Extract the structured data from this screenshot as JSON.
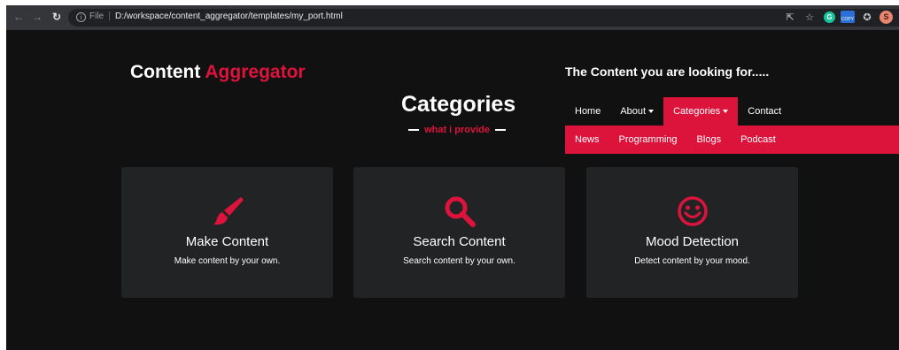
{
  "browser": {
    "back_icon": "arrow-left-icon",
    "forward_icon": "arrow-right-icon",
    "reload_icon": "reload-icon",
    "info_icon": "info-icon",
    "scheme_label": "File",
    "url": "D:/workspace/content_aggregator/templates/my_port.html",
    "extension_copy_label": "COPY",
    "profile_initial": "S",
    "extension_g_label": "G"
  },
  "brand": {
    "first": "Content",
    "accent": "Aggregator"
  },
  "tagline": "The Content you are looking for.....",
  "section": {
    "title": "Categories",
    "subtitle": "what i provide"
  },
  "menu": {
    "items": [
      {
        "label": "Home"
      },
      {
        "label": "About"
      },
      {
        "label": "Categories"
      },
      {
        "label": "Contact"
      }
    ],
    "submenu": [
      {
        "label": "News"
      },
      {
        "label": "Programming"
      },
      {
        "label": "Blogs"
      },
      {
        "label": "Podcast"
      }
    ]
  },
  "cards": [
    {
      "icon": "paint-brush-icon",
      "title": "Make Content",
      "desc": "Make content by your own."
    },
    {
      "icon": "search-icon",
      "title": "Search Content",
      "desc": "Search content by your own."
    },
    {
      "icon": "smile-icon",
      "title": "Mood Detection",
      "desc": "Detect content by your mood."
    }
  ],
  "colors": {
    "accent": "#dc143c",
    "background": "#111112",
    "card": "#222325"
  }
}
